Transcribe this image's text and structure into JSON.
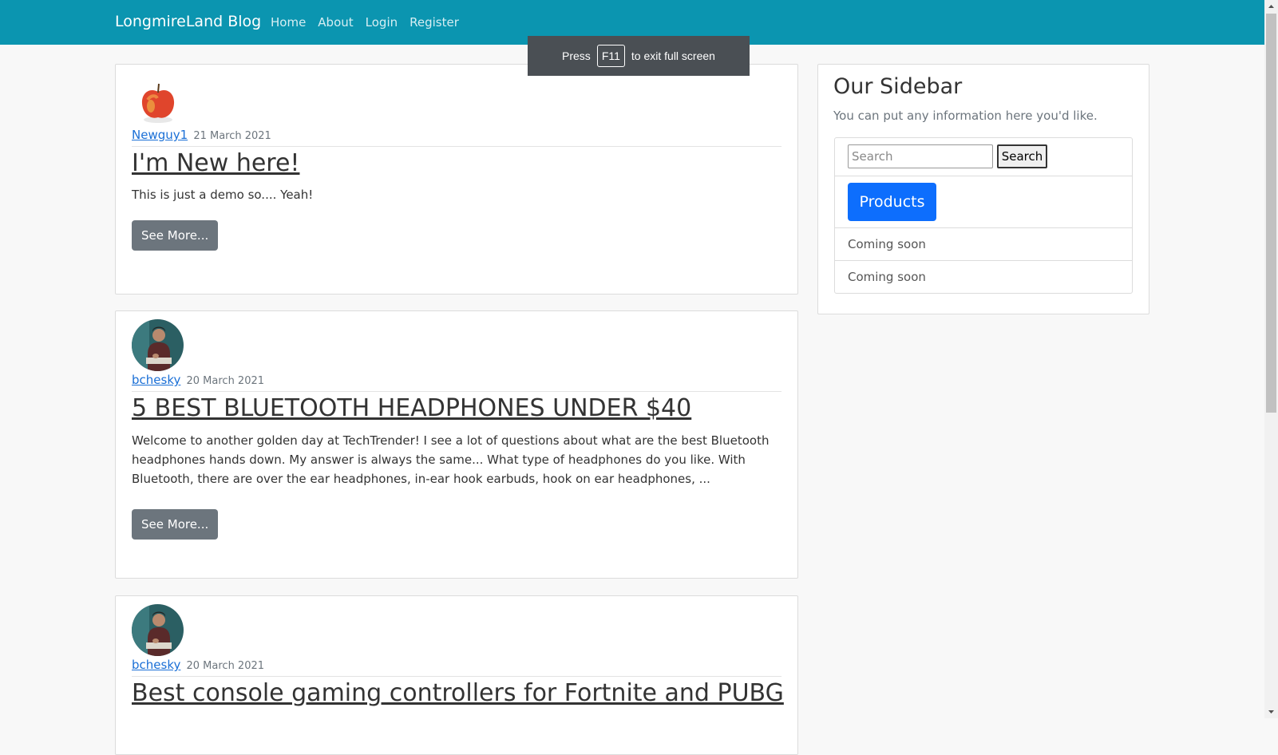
{
  "nav": {
    "brand": "LongmireLand Blog",
    "links": [
      "Home",
      "About",
      "Login",
      "Register"
    ]
  },
  "overlay": {
    "press": "Press",
    "key": "F11",
    "suffix": "to exit full screen"
  },
  "posts": [
    {
      "author": "Newguy1",
      "date": "21 March 2021",
      "title": "I'm New here!",
      "excerpt": "This is just a demo so.... Yeah!",
      "button": "See More...",
      "avatar": "apple-image"
    },
    {
      "author": "bchesky",
      "date": "20 March 2021",
      "title": "5 BEST BLUETOOTH HEADPHONES UNDER $40",
      "excerpt": "Welcome to another golden day at TechTrender! I see a lot of questions about what are the best Bluetooth headphones hands down. My answer is always the same... What type of headphones do you like. With Bluetooth, there are over the ear headphones, in-ear hook earbuds, hook on ear headphones, ...",
      "button": "See More...",
      "avatar": "person-photo"
    },
    {
      "author": "bchesky",
      "date": "20 March 2021",
      "title": "Best console gaming controllers for Fortnite and PUBG",
      "avatar": "person-photo"
    }
  ],
  "sidebar": {
    "title": "Our Sidebar",
    "description": "You can put any information here you'd like.",
    "search_placeholder": "Search",
    "search_button": "Search",
    "products_button": "Products",
    "items": [
      "Coming soon",
      "Coming soon"
    ]
  },
  "colors": {
    "navbar": "#0b95b0",
    "link": "#1a6fd6",
    "products": "#0d6efd",
    "see_more": "#6c757d"
  }
}
